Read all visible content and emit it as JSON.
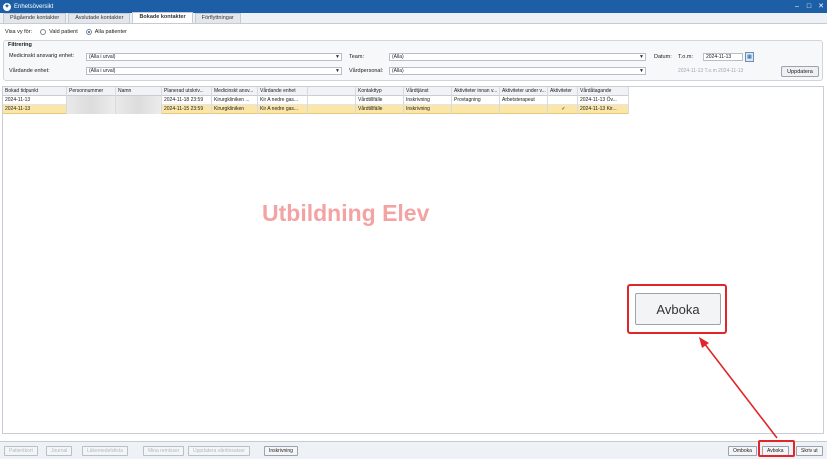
{
  "window": {
    "title": "Enhetsöversikt",
    "app_icon": "app-logo-icon",
    "controls": [
      "minimize-icon",
      "maximize-icon",
      "close-icon"
    ]
  },
  "tabs": [
    {
      "label": "Pågående kontakter"
    },
    {
      "label": "Avslutade kontakter"
    },
    {
      "label": "Bokade kontakter",
      "active": true
    },
    {
      "label": "Förflyttningar"
    }
  ],
  "view": {
    "label": "Visa vy för:",
    "option_selected_patient": "Vald patient",
    "option_all_patients": "Alla patienter",
    "selected": "Alla patienter"
  },
  "filter": {
    "title": "Filtrering",
    "responsible_unit_label": "Medicinskt ansvarig enhet:",
    "responsible_unit_value": "(Alla i urval)",
    "care_unit_label": "Vårdande enhet:",
    "care_unit_value": "(Alla i urval)",
    "team_label": "Team:",
    "team_value": "(Alla)",
    "staff_label": "Vårdpersonal:",
    "staff_value": "(Alla)",
    "date_label": "Datum:",
    "tom_label": "T.o.m:",
    "tom_value": "2024-11-13",
    "range_hint": "2024-11-13 T.o.m 2024-11-13",
    "update_button": "Uppdatera"
  },
  "table": {
    "columns": [
      "Bokad tidpunkt",
      "Personnummer",
      "Namn",
      "Planerad utskriv...",
      "Medicinskt ansv...",
      "Vårdande enhet",
      "",
      "Kontakttyp",
      "Vårdtjänst",
      "Aktiviteter innan v...",
      "Aktiviteter under v...",
      "Aktiviteter",
      "Vårdåtagande"
    ],
    "rows": [
      [
        "2024-11-13",
        "",
        "",
        "2024-11-18 23:59",
        "Kirurgkliniken ...",
        "Kir A nedre gas...",
        "",
        "Vårdtillfälle",
        "Inskrivning",
        "Provtagning",
        "Arbetsterapeut",
        "",
        "2024-11-13 Öv..."
      ],
      [
        "2024-11-13",
        "",
        "",
        "2024-11-15 23:59",
        "Kirurgkliniken",
        "Kir A nedre gas...",
        "",
        "Vårdtillfälle",
        "Inskrivning",
        "",
        "",
        "✓",
        "2024-11-13 Kir..."
      ]
    ],
    "selected_row": 1
  },
  "watermark": "Utbildning Elev",
  "callout": {
    "label": "Avboka"
  },
  "bottom_left_buttons": [
    "Patientkort",
    "Journal",
    "Läkemedelslista",
    "Mina remisser",
    "Uppdatera vårdinsatser",
    "Inskrivning"
  ],
  "bottom_right_buttons": [
    "Ombokа",
    "Avboka",
    "Skriv ut"
  ],
  "colors": {
    "titlebar": "#1d5fa6",
    "selected_row": "#fbe6a8",
    "highlight": "#e0262b",
    "watermark": "#f3a3a3"
  }
}
